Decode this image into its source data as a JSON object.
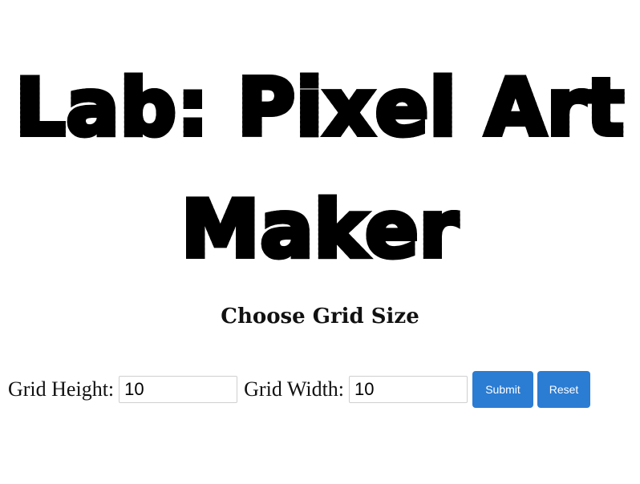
{
  "header": {
    "title_line_1": "Lab: Pixel Art",
    "title_line_2": "Maker"
  },
  "section": {
    "heading": "Choose Grid Size"
  },
  "form": {
    "height_label": "Grid Height:",
    "height_value": "10",
    "width_label": "Grid Width:",
    "width_value": "10",
    "submit_label": "Submit",
    "reset_label": "Reset"
  },
  "colors": {
    "button_background": "#2b7cd3",
    "button_text": "#ffffff",
    "text": "#111111"
  }
}
